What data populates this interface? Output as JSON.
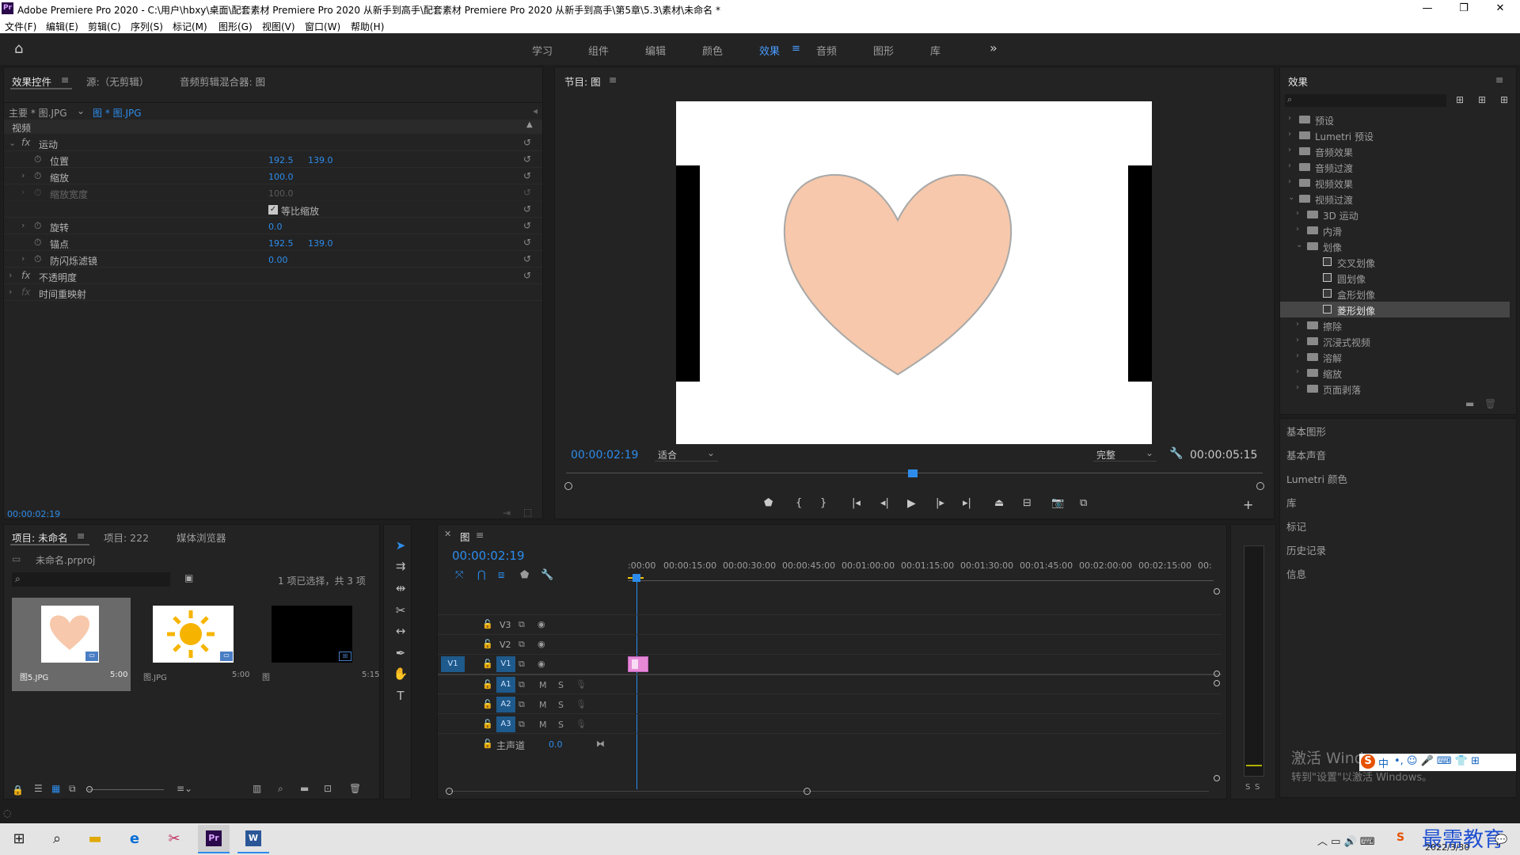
{
  "window": {
    "title": "Adobe Premiere Pro 2020 - C:\\用户\\hbxy\\桌面\\配套素材 Premiere Pro 2020 从新手到高手\\配套素材 Premiere Pro 2020 从新手到高手\\第5章\\5.3\\素材\\未命名 *"
  },
  "menu": [
    "文件(F)",
    "编辑(E)",
    "剪辑(C)",
    "序列(S)",
    "标记(M)",
    "图形(G)",
    "视图(V)",
    "窗口(W)",
    "帮助(H)"
  ],
  "workspaces": [
    "学习",
    "组件",
    "编辑",
    "颜色",
    "效果",
    "音频",
    "图形",
    "库"
  ],
  "more": "»",
  "effect_controls": {
    "tabs": [
      "效果控件",
      "源:（无剪辑）",
      "音频剪辑混合器: 图"
    ],
    "master": "主要 * 图.JPG",
    "clip": "图 * 图.JPG",
    "video_header": "视频",
    "motion": "运动",
    "rows": [
      {
        "name": "位置",
        "v1": "192.5",
        "v2": "139.0"
      },
      {
        "name": "缩放",
        "v1": "100.0",
        "v2": ""
      },
      {
        "name": "缩放宽度",
        "v1": "100.0",
        "v2": ""
      },
      {
        "name": "等比缩放",
        "v1": "",
        "v2": ""
      },
      {
        "name": "旋转",
        "v1": "0.0",
        "v2": ""
      },
      {
        "name": "锚点",
        "v1": "192.5",
        "v2": "139.0"
      },
      {
        "name": "防闪烁滤镜",
        "v1": "0.00",
        "v2": ""
      }
    ],
    "opacity": "不透明度",
    "remap": "时间重映射",
    "timecode": "00:00:02:19"
  },
  "program": {
    "title": "节目: 图",
    "timecode": "00:00:02:19",
    "fit": "适合",
    "quality": "完整",
    "duration": "00:00:05:15",
    "playhead": 0.5
  },
  "effects": {
    "title": "效果",
    "items": [
      {
        "label": "预设",
        "level": 0,
        "open": false
      },
      {
        "label": "Lumetri 预设",
        "level": 0,
        "open": false
      },
      {
        "label": "音频效果",
        "level": 0,
        "open": false
      },
      {
        "label": "音频过渡",
        "level": 0,
        "open": false
      },
      {
        "label": "视频效果",
        "level": 0,
        "open": false
      },
      {
        "label": "视频过渡",
        "level": 0,
        "open": true
      },
      {
        "label": "3D 运动",
        "level": 1,
        "open": false
      },
      {
        "label": "内滑",
        "level": 1,
        "open": false
      },
      {
        "label": "划像",
        "level": 1,
        "open": true
      },
      {
        "label": "交叉划像",
        "level": 2,
        "leaf": true
      },
      {
        "label": "圆划像",
        "level": 2,
        "leaf": true
      },
      {
        "label": "盒形划像",
        "level": 2,
        "leaf": true
      },
      {
        "label": "菱形划像",
        "level": 2,
        "leaf": true,
        "selected": true
      },
      {
        "label": "擦除",
        "level": 1,
        "open": false
      },
      {
        "label": "沉浸式视频",
        "level": 1,
        "open": false
      },
      {
        "label": "溶解",
        "level": 1,
        "open": false
      },
      {
        "label": "缩放",
        "level": 1,
        "open": false
      },
      {
        "label": "页面剥落",
        "level": 1,
        "open": false
      }
    ],
    "side_panels": [
      "基本图形",
      "基本声音",
      "Lumetri 颜色",
      "库",
      "标记",
      "历史记录",
      "信息"
    ]
  },
  "project": {
    "tabs": [
      "项目: 未命名",
      "项目: 222",
      "媒体浏览器"
    ],
    "file": "未命名.prproj",
    "selection": "1 项已选择，共 3 项",
    "items": [
      {
        "name": "图5.JPG",
        "dur": "5:00"
      },
      {
        "name": "图.JPG",
        "dur": "5:00"
      },
      {
        "name": "图",
        "dur": "5:15"
      }
    ]
  },
  "timeline": {
    "title": "图",
    "timecode": "00:00:02:19",
    "ticks": [
      ":00:00",
      "00:00:15:00",
      "00:00:30:00",
      "00:00:45:00",
      "00:01:00:00",
      "00:01:15:00",
      "00:01:30:00",
      "00:01:45:00",
      "00:02:00:00",
      "00:02:15:00",
      "00:"
    ],
    "video_tracks": [
      "V3",
      "V2",
      "V1"
    ],
    "audio_tracks": [
      "A1",
      "A2",
      "A3"
    ],
    "source_v": "V1",
    "mix": "主声道",
    "mix_value": "0.0"
  },
  "meter": {
    "labels": [
      "S",
      "S"
    ]
  },
  "watermark": {
    "line1": "激活 Windows",
    "line2": "转到\"设置\"以激活 Windows。",
    "brand": "最需教育",
    "date": "2022/3/30"
  },
  "ime": "中"
}
